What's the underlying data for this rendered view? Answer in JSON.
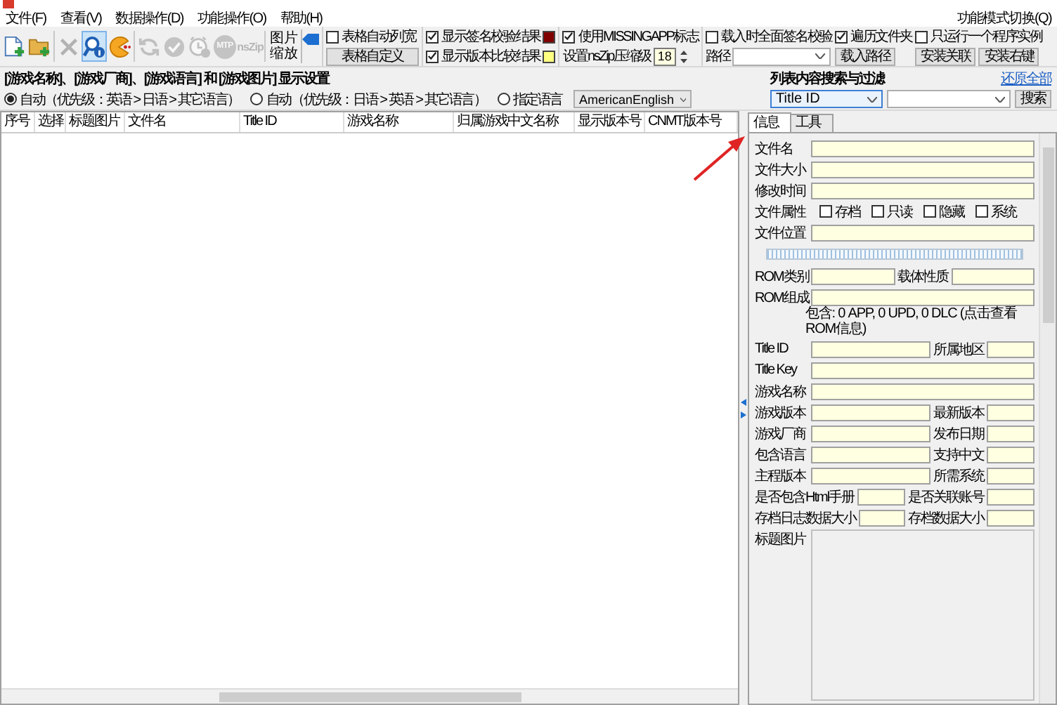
{
  "menu": [
    {
      "label": "文件(F)"
    },
    {
      "label": "查看(V)"
    },
    {
      "label": "数据操作(D)"
    },
    {
      "label": "功能操作(O)"
    },
    {
      "label": "帮助(H)"
    }
  ],
  "mode_switch": "功能模式切换(Q)",
  "toolbar": {
    "tools": [
      {
        "kind": "new-file",
        "disabled": false,
        "selected": false
      },
      {
        "kind": "add-folder",
        "disabled": false,
        "selected": false
      },
      {
        "kind": "delete",
        "disabled": true,
        "selected": false
      },
      {
        "kind": "search-info",
        "disabled": false,
        "selected": true
      },
      {
        "kind": "pacman",
        "disabled": false,
        "selected": false
      },
      {
        "kind": "refresh",
        "disabled": true,
        "selected": false
      },
      {
        "kind": "check",
        "disabled": true,
        "selected": false
      },
      {
        "kind": "alarm",
        "disabled": true,
        "selected": false
      },
      {
        "kind": "mtp",
        "label": "MTP",
        "disabled": true,
        "selected": false
      },
      {
        "kind": "nszip",
        "label": "nsZip",
        "disabled": true,
        "selected": false
      }
    ],
    "zoom": {
      "label": "图片缩放",
      "level": 0.8
    },
    "auto_width": {
      "label": "表格自动列宽",
      "checked": false
    },
    "customize_button": "表格自定义",
    "result_options": [
      {
        "label": "显示签名校验结果",
        "checked": true,
        "color": "#800000"
      },
      {
        "label": "显示版本比较结果",
        "checked": true,
        "color": "#ffff80"
      }
    ],
    "missing_app": {
      "label": "使用MISSINGAPP标志",
      "checked": true
    },
    "nszip_level": {
      "label": "设置nsZip压缩级",
      "value": "18"
    },
    "load_options": [
      {
        "label": "载入时全面签名校验",
        "checked": false
      },
      {
        "label": "遍历文件夹",
        "checked": true
      },
      {
        "label": "只运行一个程序实例",
        "checked": false
      }
    ],
    "path_label": "路径",
    "load_path_button": "载入路径",
    "install_buttons": [
      "安装关联",
      "安装右键"
    ]
  },
  "display_settings": {
    "title": "[游戏名称]、[游戏厂商]、[游戏语言] 和 [游戏图片] 显示设置",
    "options": [
      {
        "label": "自动（优先级：英语 > 日语 > 其它语言）",
        "selected": true
      },
      {
        "label": "自动（优先级：日语 > 英语 > 其它语言）",
        "selected": false
      },
      {
        "label": "指定语言",
        "selected": false
      }
    ],
    "language": "AmericanEnglish"
  },
  "search": {
    "title": "列表内容搜索与过滤",
    "reset_link": "还原全部",
    "column": "Title ID",
    "button": "搜索"
  },
  "table": {
    "columns": [
      "序号",
      "选择",
      "标题图片",
      "文件名",
      "Title ID",
      "游戏名称",
      "归属游戏中文名称",
      "显示版本号",
      "CNMT版本号"
    ]
  },
  "details": {
    "tabs": [
      {
        "label": "信息",
        "selected": true
      },
      {
        "label": "工具",
        "selected": false
      }
    ],
    "rows": [
      {
        "kind": "field",
        "label": "文件名"
      },
      {
        "kind": "field",
        "label": "文件大小"
      },
      {
        "kind": "field",
        "label": "修改时间"
      },
      {
        "kind": "attributes",
        "label": "文件属性",
        "options": [
          {
            "label": "存档",
            "checked": false
          },
          {
            "label": "只读",
            "checked": false
          },
          {
            "label": "隐藏",
            "checked": false
          },
          {
            "label": "系统",
            "checked": false
          }
        ]
      },
      {
        "kind": "field",
        "label": "文件位置"
      },
      {
        "kind": "bar"
      },
      {
        "kind": "pair-even",
        "label": "ROM类别",
        "label2": "载体性质"
      },
      {
        "kind": "rom",
        "label": "ROM组成",
        "note": "包含: 0 APP, 0 UPD, 0 DLC (点击查看ROM信息)"
      },
      {
        "kind": "pair",
        "label": "Title ID",
        "label2": "所属地区"
      },
      {
        "kind": "field",
        "label": "Title Key"
      },
      {
        "kind": "field",
        "label": "游戏名称"
      },
      {
        "kind": "pair",
        "label": "游戏版本",
        "label2": "最新版本"
      },
      {
        "kind": "pair",
        "label": "游戏厂商",
        "label2": "发布日期"
      },
      {
        "kind": "pair",
        "label": "包含语言",
        "label2": "支持中文"
      },
      {
        "kind": "pair",
        "label": "主程版本",
        "label2": "所需系统"
      },
      {
        "kind": "pair-long",
        "label": "是否包含Html手册",
        "label2": "是否关联账号"
      },
      {
        "kind": "pair-long",
        "label": "存档日志数据大小",
        "label2": "存档数据大小"
      },
      {
        "kind": "image",
        "label": "标题图片"
      }
    ]
  }
}
